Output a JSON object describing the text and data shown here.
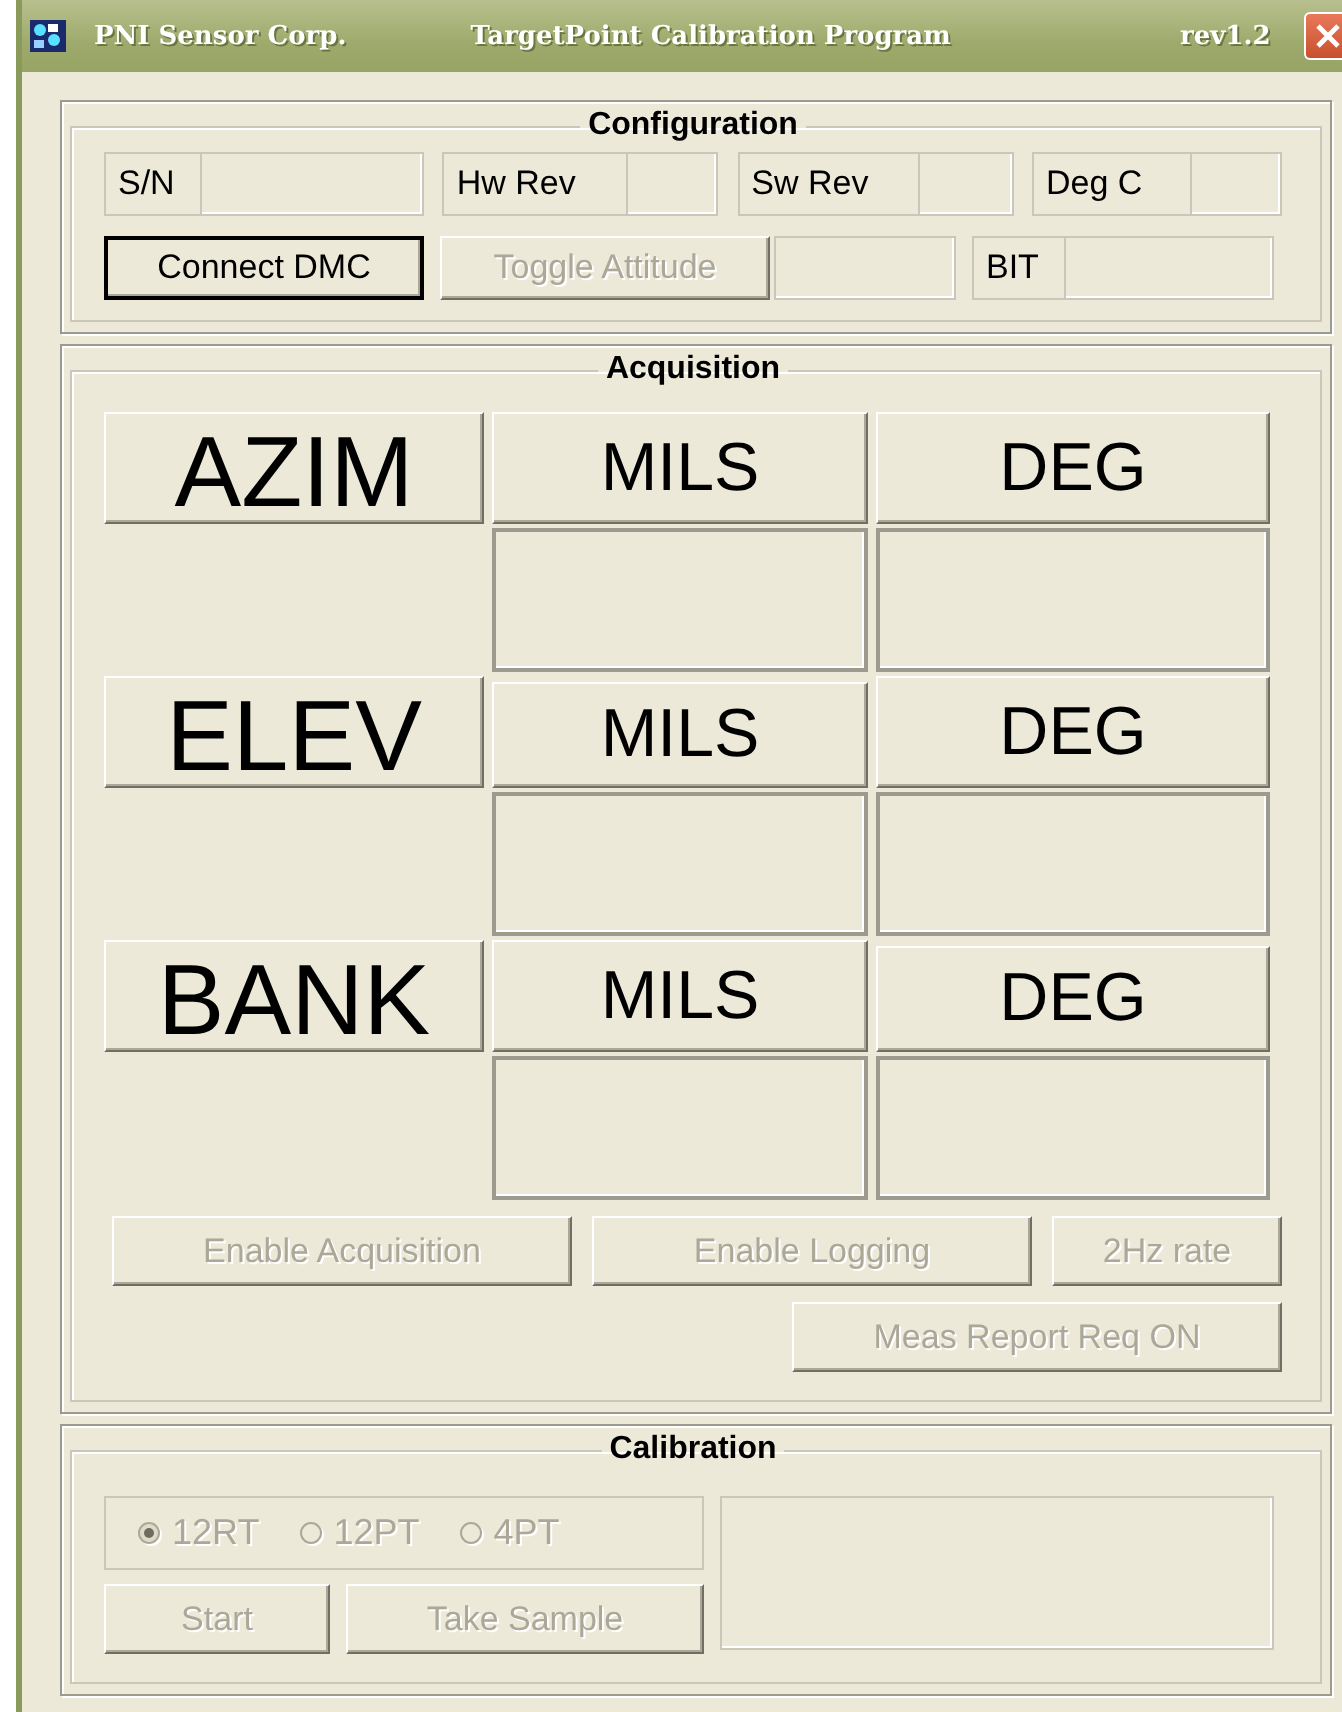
{
  "window": {
    "company": "PNI Sensor Corp.",
    "title": "TargetPoint Calibration Program",
    "version": "rev1.2"
  },
  "configuration": {
    "title": "Configuration",
    "fields": [
      {
        "label": "S/N"
      },
      {
        "label": "Hw Rev"
      },
      {
        "label": "Sw Rev"
      },
      {
        "label": "Deg C"
      }
    ],
    "connect_button": {
      "label": "Connect DMC",
      "disabled": false
    },
    "toggle_button": {
      "label": "Toggle Attitude",
      "disabled": true
    },
    "bit_label": "BIT"
  },
  "acquisition": {
    "title": "Acquisition",
    "axes": [
      {
        "name": "AZIM",
        "units": [
          "MILS",
          "DEG"
        ]
      },
      {
        "name": "ELEV",
        "units": [
          "MILS",
          "DEG"
        ]
      },
      {
        "name": "BANK",
        "units": [
          "MILS",
          "DEG"
        ]
      }
    ],
    "buttons": [
      {
        "label": "Enable Acquisition",
        "disabled": true
      },
      {
        "label": "Enable Logging",
        "disabled": true
      },
      {
        "label": "2Hz rate",
        "disabled": true
      },
      {
        "label": "Meas Report Req ON",
        "disabled": true
      }
    ]
  },
  "calibration": {
    "title": "Calibration",
    "modes": [
      {
        "label": "12RT",
        "selected": true,
        "disabled": true
      },
      {
        "label": "12PT",
        "selected": false,
        "disabled": true
      },
      {
        "label": "4PT",
        "selected": false,
        "disabled": true
      }
    ],
    "buttons": [
      {
        "label": "Start",
        "disabled": true
      },
      {
        "label": "Take Sample",
        "disabled": true
      }
    ]
  }
}
